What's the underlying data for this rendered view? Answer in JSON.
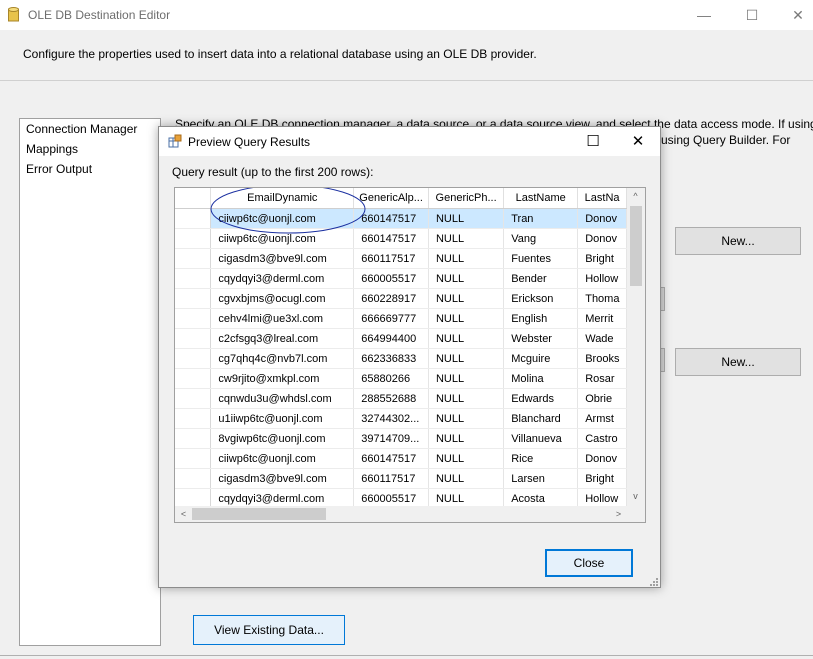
{
  "window": {
    "title": "OLE DB Destination Editor",
    "minimize_glyph": "—",
    "maximize_glyph": "☐",
    "close_glyph": "✕",
    "description": "Configure the properties used to insert data into a relational database using an OLE DB provider."
  },
  "nav": {
    "items": [
      {
        "label": "Connection Manager"
      },
      {
        "label": "Mappings"
      },
      {
        "label": "Error Output"
      }
    ]
  },
  "background": {
    "specify_text_left": "Specify an OLE DB connection manager, a data source, or a data source view, and select the data access mode. If using",
    "specify_text_right": "using Query Builder. For",
    "new_button_1": "New...",
    "new_button_2": "New...",
    "view_existing_button": "View Existing Data..."
  },
  "dialog": {
    "title": "Preview Query Results",
    "maximize_glyph": "☐",
    "close_glyph": "✕",
    "query_label": "Query result (up to the first 200 rows):",
    "close_button": "Close",
    "scroll_left": "<",
    "scroll_right": ">",
    "scroll_up": "^",
    "scroll_down": "v"
  },
  "grid": {
    "columns": [
      "EmailDynamic",
      "GenericAlp...",
      "GenericPh...",
      "LastName",
      "LastNa"
    ],
    "rows": [
      {
        "email": "ciiwp6tc@uonjl.com",
        "alp": "660147517",
        "ph": "NULL",
        "last": "Tran",
        "last2": "Donov"
      },
      {
        "email": "ciiwp6tc@uonjl.com",
        "alp": "660147517",
        "ph": "NULL",
        "last": "Vang",
        "last2": "Donov"
      },
      {
        "email": "cigasdm3@bve9l.com",
        "alp": "660117517",
        "ph": "NULL",
        "last": "Fuentes",
        "last2": "Bright"
      },
      {
        "email": "cqydqyi3@derml.com",
        "alp": "660005517",
        "ph": "NULL",
        "last": "Bender",
        "last2": "Hollow"
      },
      {
        "email": "cgvxbjms@ocugl.com",
        "alp": "660228917",
        "ph": "NULL",
        "last": "Erickson",
        "last2": "Thoma"
      },
      {
        "email": "cehv4lmi@ue3xl.com",
        "alp": "666669777",
        "ph": "NULL",
        "last": "English",
        "last2": "Merrit"
      },
      {
        "email": "c2cfsgq3@lreal.com",
        "alp": "664994400",
        "ph": "NULL",
        "last": "Webster",
        "last2": "Wade"
      },
      {
        "email": "cg7qhq4c@nvb7l.com",
        "alp": "662336833",
        "ph": "NULL",
        "last": "Mcguire",
        "last2": "Brooks"
      },
      {
        "email": "cw9rjito@xmkpl.com",
        "alp": "65880266",
        "ph": "NULL",
        "last": "Molina",
        "last2": "Rosar"
      },
      {
        "email": "cqnwdu3u@whdsl.com",
        "alp": "288552688",
        "ph": "NULL",
        "last": "Edwards",
        "last2": "Obrie"
      },
      {
        "email": "u1iiwp6tc@uonjl.com",
        "alp": "32744302...",
        "ph": "NULL",
        "last": "Blanchard",
        "last2": "Armst"
      },
      {
        "email": "8vgiwp6tc@uonjl.com",
        "alp": "39714709...",
        "ph": "NULL",
        "last": "Villanueva",
        "last2": "Castro"
      },
      {
        "email": "ciiwp6tc@uonjl.com",
        "alp": "660147517",
        "ph": "NULL",
        "last": "Rice",
        "last2": "Donov"
      },
      {
        "email": "cigasdm3@bve9l.com",
        "alp": "660117517",
        "ph": "NULL",
        "last": "Larsen",
        "last2": "Bright"
      },
      {
        "email": "cqydqyi3@derml.com",
        "alp": "660005517",
        "ph": "NULL",
        "last": "Acosta",
        "last2": "Hollow"
      }
    ]
  },
  "colors": {
    "selection": "#cce8ff",
    "annotation": "#1a2fa0",
    "focus_border": "#0078d7"
  }
}
